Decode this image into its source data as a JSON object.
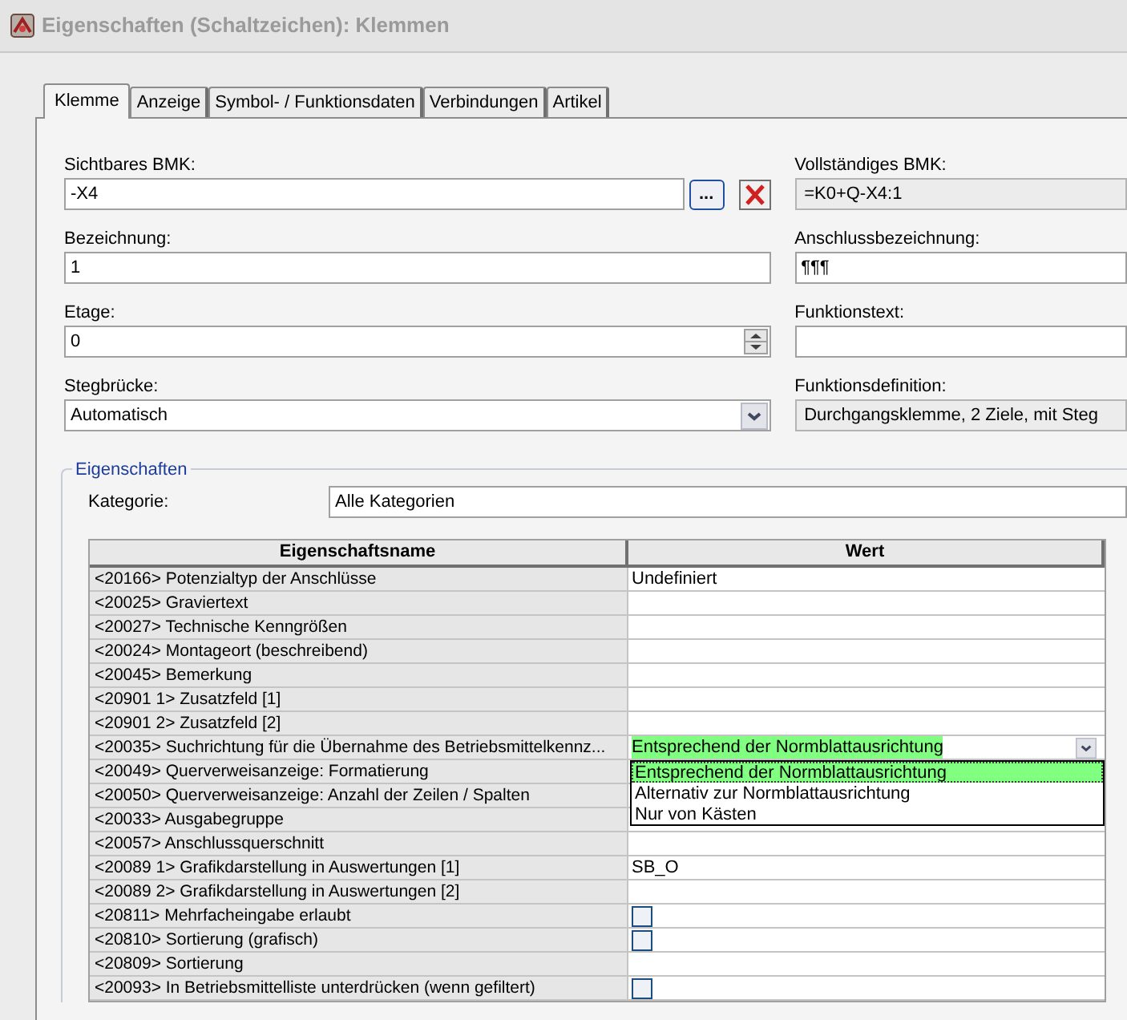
{
  "window": {
    "title": "Eigenschaften (Schaltzeichen): Klemmen"
  },
  "tabs": [
    {
      "label": "Klemme",
      "selected": true
    },
    {
      "label": "Anzeige",
      "selected": false
    },
    {
      "label": "Symbol- / Funktionsdaten",
      "selected": false
    },
    {
      "label": "Verbindungen",
      "selected": false
    },
    {
      "label": "Artikel",
      "selected": false
    }
  ],
  "fields_left": [
    {
      "label": "Sichtbares BMK:",
      "value": "-X4",
      "kind": "browse",
      "browse_label": "..."
    },
    {
      "label": "Bezeichnung:",
      "value": "1",
      "kind": "text"
    },
    {
      "label": "Etage:",
      "value": "0",
      "kind": "spin"
    },
    {
      "label": "Stegbrücke:",
      "value": "Automatisch",
      "kind": "dropdown"
    }
  ],
  "fields_right": [
    {
      "label": "Vollständiges BMK:",
      "value": "=K0+Q-X4:1",
      "kind": "readonly"
    },
    {
      "label": "Anschlussbezeichnung:",
      "value": "¶¶¶",
      "kind": "text"
    },
    {
      "label": "Funktionstext:",
      "kind": "text"
    },
    {
      "label": "Funktionsdefinition:",
      "value": "Durchgangsklemme, 2 Ziele, mit Steg",
      "kind": "readonly"
    }
  ],
  "properties": {
    "title": "Eigenschaften",
    "category_label": "Kategorie:",
    "category_value": "Alle Kategorien",
    "table": {
      "columns": [
        "Eigenschaftsname",
        "Wert"
      ],
      "rows": [
        {
          "name": "<20166> Potenzialtyp der Anschlüsse",
          "kind": "text",
          "value": "Undefiniert"
        },
        {
          "name": "<20025> Graviertext",
          "kind": "text"
        },
        {
          "name": "<20027> Technische Kenngrößen",
          "kind": "text"
        },
        {
          "name": "<20024> Montageort (beschreibend)",
          "kind": "text"
        },
        {
          "name": "<20045> Bemerkung",
          "kind": "text"
        },
        {
          "name": "<20901 1> Zusatzfeld [1]",
          "kind": "text"
        },
        {
          "name": "<20901 2> Zusatzfeld [2]",
          "kind": "text"
        },
        {
          "name": "<20035> Suchrichtung für die Übernahme des Betriebsmittelkennz...",
          "kind": "dropdown",
          "value": "Entsprechend der Normblattausrichtung",
          "options": [
            {
              "label": "Entsprechend der Normblattausrichtung",
              "selected": true
            },
            {
              "label": "Alternativ zur Normblattausrichtung",
              "selected": false
            },
            {
              "label": "Nur von Kästen",
              "selected": false
            }
          ]
        },
        {
          "name": "<20049> Querverweisanzeige: Formatierung",
          "kind": "text"
        },
        {
          "name": "<20050> Querverweisanzeige: Anzahl der Zeilen / Spalten",
          "kind": "text"
        },
        {
          "name": "<20033> Ausgabegruppe",
          "kind": "text"
        },
        {
          "name": "<20057> Anschlussquerschnitt",
          "kind": "text"
        },
        {
          "name": "<20089 1> Grafikdarstellung in Auswertungen [1]",
          "kind": "text",
          "value": "SB_O"
        },
        {
          "name": "<20089 2> Grafikdarstellung in Auswertungen [2]",
          "kind": "text"
        },
        {
          "name": "<20811> Mehrfacheingabe erlaubt",
          "kind": "checkbox",
          "checked": false
        },
        {
          "name": "<20810> Sortierung (grafisch)",
          "kind": "checkbox",
          "checked": false
        },
        {
          "name": "<20809> Sortierung",
          "kind": "text"
        },
        {
          "name": "<20093> In Betriebsmittelliste unterdrücken (wenn gefiltert)",
          "kind": "checkbox",
          "checked": false
        }
      ]
    }
  }
}
